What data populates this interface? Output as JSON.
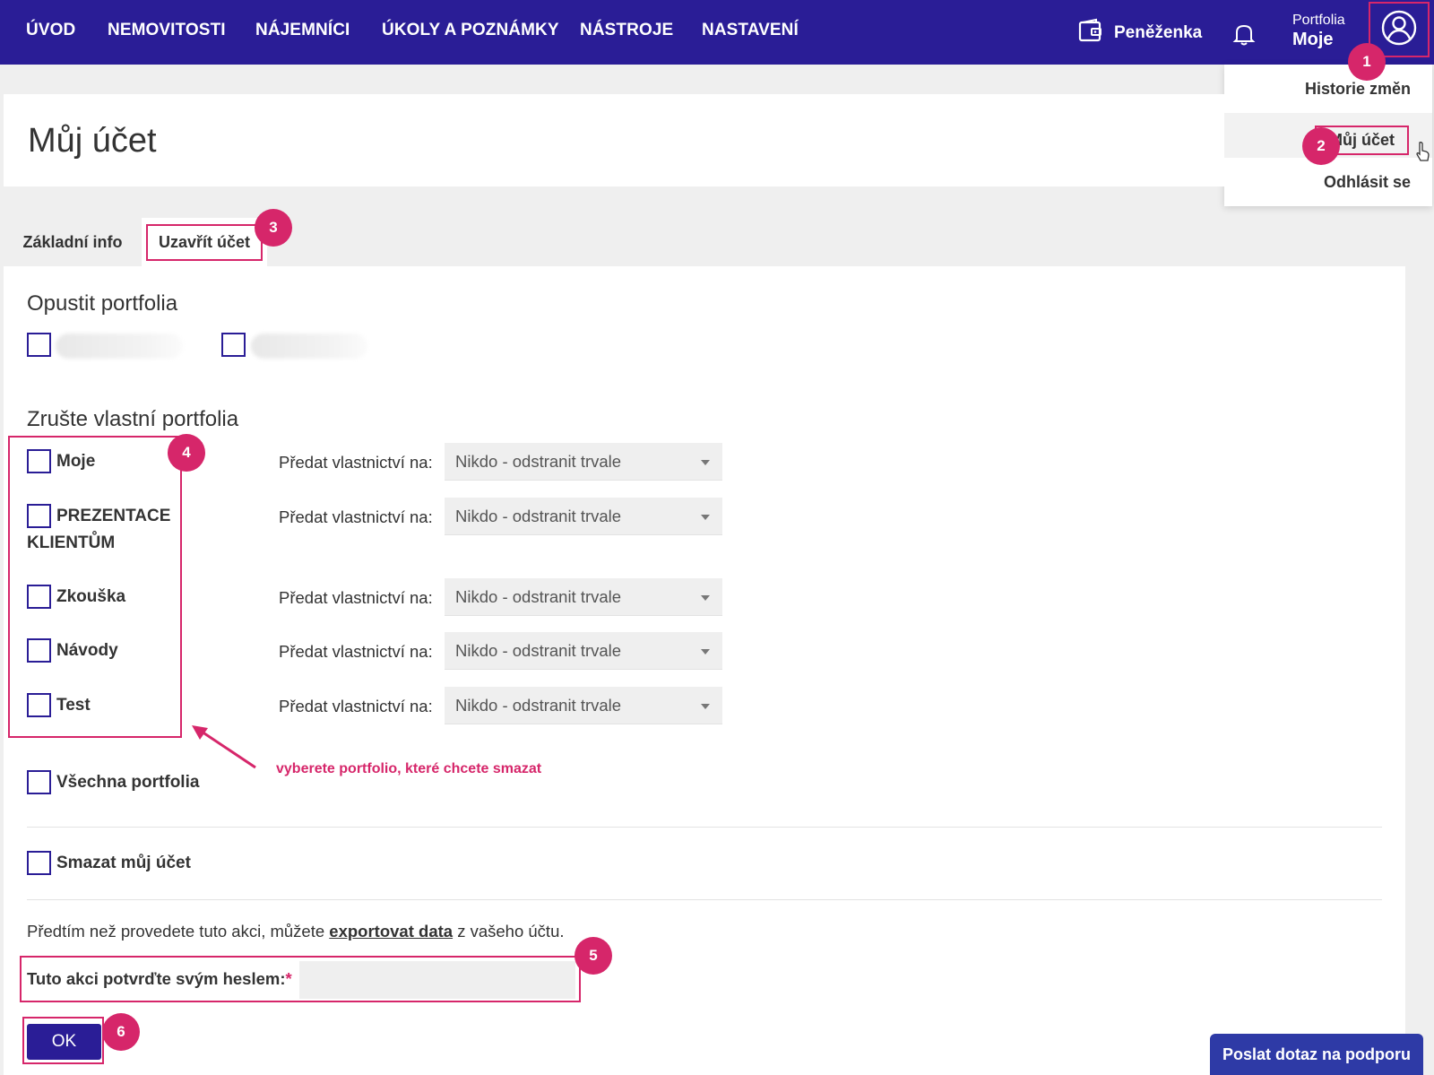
{
  "nav": {
    "items": [
      "ÚVOD",
      "NEMOVITOSTI",
      "NÁJEMNÍCI",
      "ÚKOLY A POZNÁMKY",
      "NÁSTROJE",
      "NASTAVENÍ"
    ],
    "wallet_label": "Peněženka",
    "portfolio_label": "Portfolia",
    "portfolio_value": "Moje"
  },
  "user_menu": {
    "items": [
      "Historie změn",
      "Můj účet",
      "Odhlásit se"
    ]
  },
  "page": {
    "title": "Můj účet"
  },
  "tabs": [
    "Základní info",
    "Uzavřít účet"
  ],
  "leave_section": {
    "title": "Opustit portfolia"
  },
  "cancel_section": {
    "title": "Zrušte vlastní portfolia",
    "transfer_label": "Předat vlastnictví na:",
    "portfolios": [
      {
        "name_line1": "Moje",
        "name_line2": "",
        "transfer_to": "Nikdo - odstranit trvale",
        "checked": false
      },
      {
        "name_line1": "PREZENTACE",
        "name_line2": "KLIENTŮM",
        "transfer_to": "Nikdo - odstranit trvale",
        "checked": false
      },
      {
        "name_line1": "Zkouška",
        "name_line2": "",
        "transfer_to": "Nikdo - odstranit trvale",
        "checked": false
      },
      {
        "name_line1": "Návody",
        "name_line2": "",
        "transfer_to": "Nikdo - odstranit trvale",
        "checked": false
      },
      {
        "name_line1": "Test",
        "name_line2": "",
        "transfer_to": "Nikdo - odstranit trvale",
        "checked": false
      }
    ],
    "all_label": "Všechna portfolia"
  },
  "delete_account_label": "Smazat můj účet",
  "info": {
    "before": "Předtím než provedete tuto akci, můžete ",
    "link": "exportovat data",
    "after": " z vašeho účtu."
  },
  "password": {
    "label": "Tuto akci potvrďte svým heslem:",
    "required_mark": "*",
    "value": ""
  },
  "ok_label": "OK",
  "support_label": "Poslat dotaz na podporu",
  "annotations": {
    "badges": [
      "1",
      "2",
      "3",
      "4",
      "5",
      "6"
    ],
    "hint": "vyberete portfolio, které chcete smazat"
  },
  "colors": {
    "nav_bg": "#2a1d96",
    "accent": "#d6266a",
    "primary_button": "#2a1d96",
    "support_button": "#2e3aa6"
  }
}
